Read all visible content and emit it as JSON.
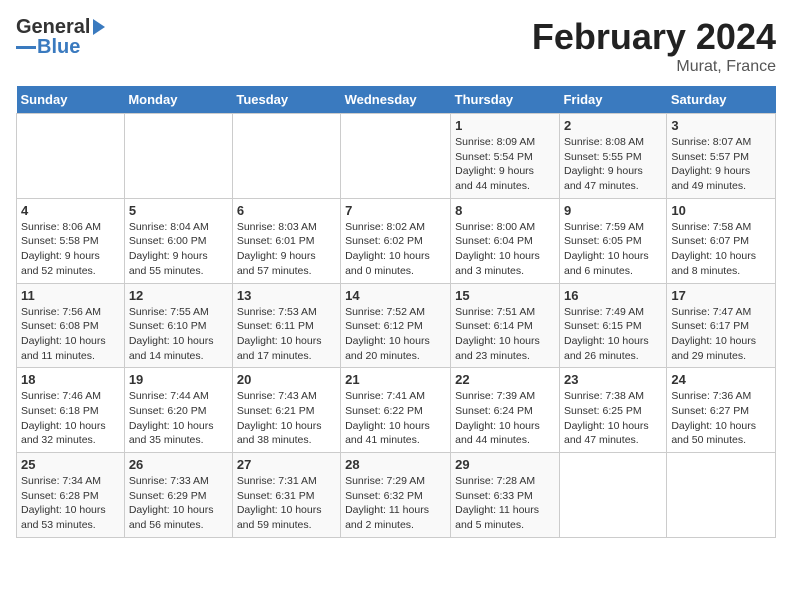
{
  "logo": {
    "line1": "General",
    "line2": "Blue"
  },
  "title": "February 2024",
  "subtitle": "Murat, France",
  "days_of_week": [
    "Sunday",
    "Monday",
    "Tuesday",
    "Wednesday",
    "Thursday",
    "Friday",
    "Saturday"
  ],
  "weeks": [
    [
      {
        "day": "",
        "info": ""
      },
      {
        "day": "",
        "info": ""
      },
      {
        "day": "",
        "info": ""
      },
      {
        "day": "",
        "info": ""
      },
      {
        "day": "1",
        "info": "Sunrise: 8:09 AM\nSunset: 5:54 PM\nDaylight: 9 hours\nand 44 minutes."
      },
      {
        "day": "2",
        "info": "Sunrise: 8:08 AM\nSunset: 5:55 PM\nDaylight: 9 hours\nand 47 minutes."
      },
      {
        "day": "3",
        "info": "Sunrise: 8:07 AM\nSunset: 5:57 PM\nDaylight: 9 hours\nand 49 minutes."
      }
    ],
    [
      {
        "day": "4",
        "info": "Sunrise: 8:06 AM\nSunset: 5:58 PM\nDaylight: 9 hours\nand 52 minutes."
      },
      {
        "day": "5",
        "info": "Sunrise: 8:04 AM\nSunset: 6:00 PM\nDaylight: 9 hours\nand 55 minutes."
      },
      {
        "day": "6",
        "info": "Sunrise: 8:03 AM\nSunset: 6:01 PM\nDaylight: 9 hours\nand 57 minutes."
      },
      {
        "day": "7",
        "info": "Sunrise: 8:02 AM\nSunset: 6:02 PM\nDaylight: 10 hours\nand 0 minutes."
      },
      {
        "day": "8",
        "info": "Sunrise: 8:00 AM\nSunset: 6:04 PM\nDaylight: 10 hours\nand 3 minutes."
      },
      {
        "day": "9",
        "info": "Sunrise: 7:59 AM\nSunset: 6:05 PM\nDaylight: 10 hours\nand 6 minutes."
      },
      {
        "day": "10",
        "info": "Sunrise: 7:58 AM\nSunset: 6:07 PM\nDaylight: 10 hours\nand 8 minutes."
      }
    ],
    [
      {
        "day": "11",
        "info": "Sunrise: 7:56 AM\nSunset: 6:08 PM\nDaylight: 10 hours\nand 11 minutes."
      },
      {
        "day": "12",
        "info": "Sunrise: 7:55 AM\nSunset: 6:10 PM\nDaylight: 10 hours\nand 14 minutes."
      },
      {
        "day": "13",
        "info": "Sunrise: 7:53 AM\nSunset: 6:11 PM\nDaylight: 10 hours\nand 17 minutes."
      },
      {
        "day": "14",
        "info": "Sunrise: 7:52 AM\nSunset: 6:12 PM\nDaylight: 10 hours\nand 20 minutes."
      },
      {
        "day": "15",
        "info": "Sunrise: 7:51 AM\nSunset: 6:14 PM\nDaylight: 10 hours\nand 23 minutes."
      },
      {
        "day": "16",
        "info": "Sunrise: 7:49 AM\nSunset: 6:15 PM\nDaylight: 10 hours\nand 26 minutes."
      },
      {
        "day": "17",
        "info": "Sunrise: 7:47 AM\nSunset: 6:17 PM\nDaylight: 10 hours\nand 29 minutes."
      }
    ],
    [
      {
        "day": "18",
        "info": "Sunrise: 7:46 AM\nSunset: 6:18 PM\nDaylight: 10 hours\nand 32 minutes."
      },
      {
        "day": "19",
        "info": "Sunrise: 7:44 AM\nSunset: 6:20 PM\nDaylight: 10 hours\nand 35 minutes."
      },
      {
        "day": "20",
        "info": "Sunrise: 7:43 AM\nSunset: 6:21 PM\nDaylight: 10 hours\nand 38 minutes."
      },
      {
        "day": "21",
        "info": "Sunrise: 7:41 AM\nSunset: 6:22 PM\nDaylight: 10 hours\nand 41 minutes."
      },
      {
        "day": "22",
        "info": "Sunrise: 7:39 AM\nSunset: 6:24 PM\nDaylight: 10 hours\nand 44 minutes."
      },
      {
        "day": "23",
        "info": "Sunrise: 7:38 AM\nSunset: 6:25 PM\nDaylight: 10 hours\nand 47 minutes."
      },
      {
        "day": "24",
        "info": "Sunrise: 7:36 AM\nSunset: 6:27 PM\nDaylight: 10 hours\nand 50 minutes."
      }
    ],
    [
      {
        "day": "25",
        "info": "Sunrise: 7:34 AM\nSunset: 6:28 PM\nDaylight: 10 hours\nand 53 minutes."
      },
      {
        "day": "26",
        "info": "Sunrise: 7:33 AM\nSunset: 6:29 PM\nDaylight: 10 hours\nand 56 minutes."
      },
      {
        "day": "27",
        "info": "Sunrise: 7:31 AM\nSunset: 6:31 PM\nDaylight: 10 hours\nand 59 minutes."
      },
      {
        "day": "28",
        "info": "Sunrise: 7:29 AM\nSunset: 6:32 PM\nDaylight: 11 hours\nand 2 minutes."
      },
      {
        "day": "29",
        "info": "Sunrise: 7:28 AM\nSunset: 6:33 PM\nDaylight: 11 hours\nand 5 minutes."
      },
      {
        "day": "",
        "info": ""
      },
      {
        "day": "",
        "info": ""
      }
    ]
  ]
}
